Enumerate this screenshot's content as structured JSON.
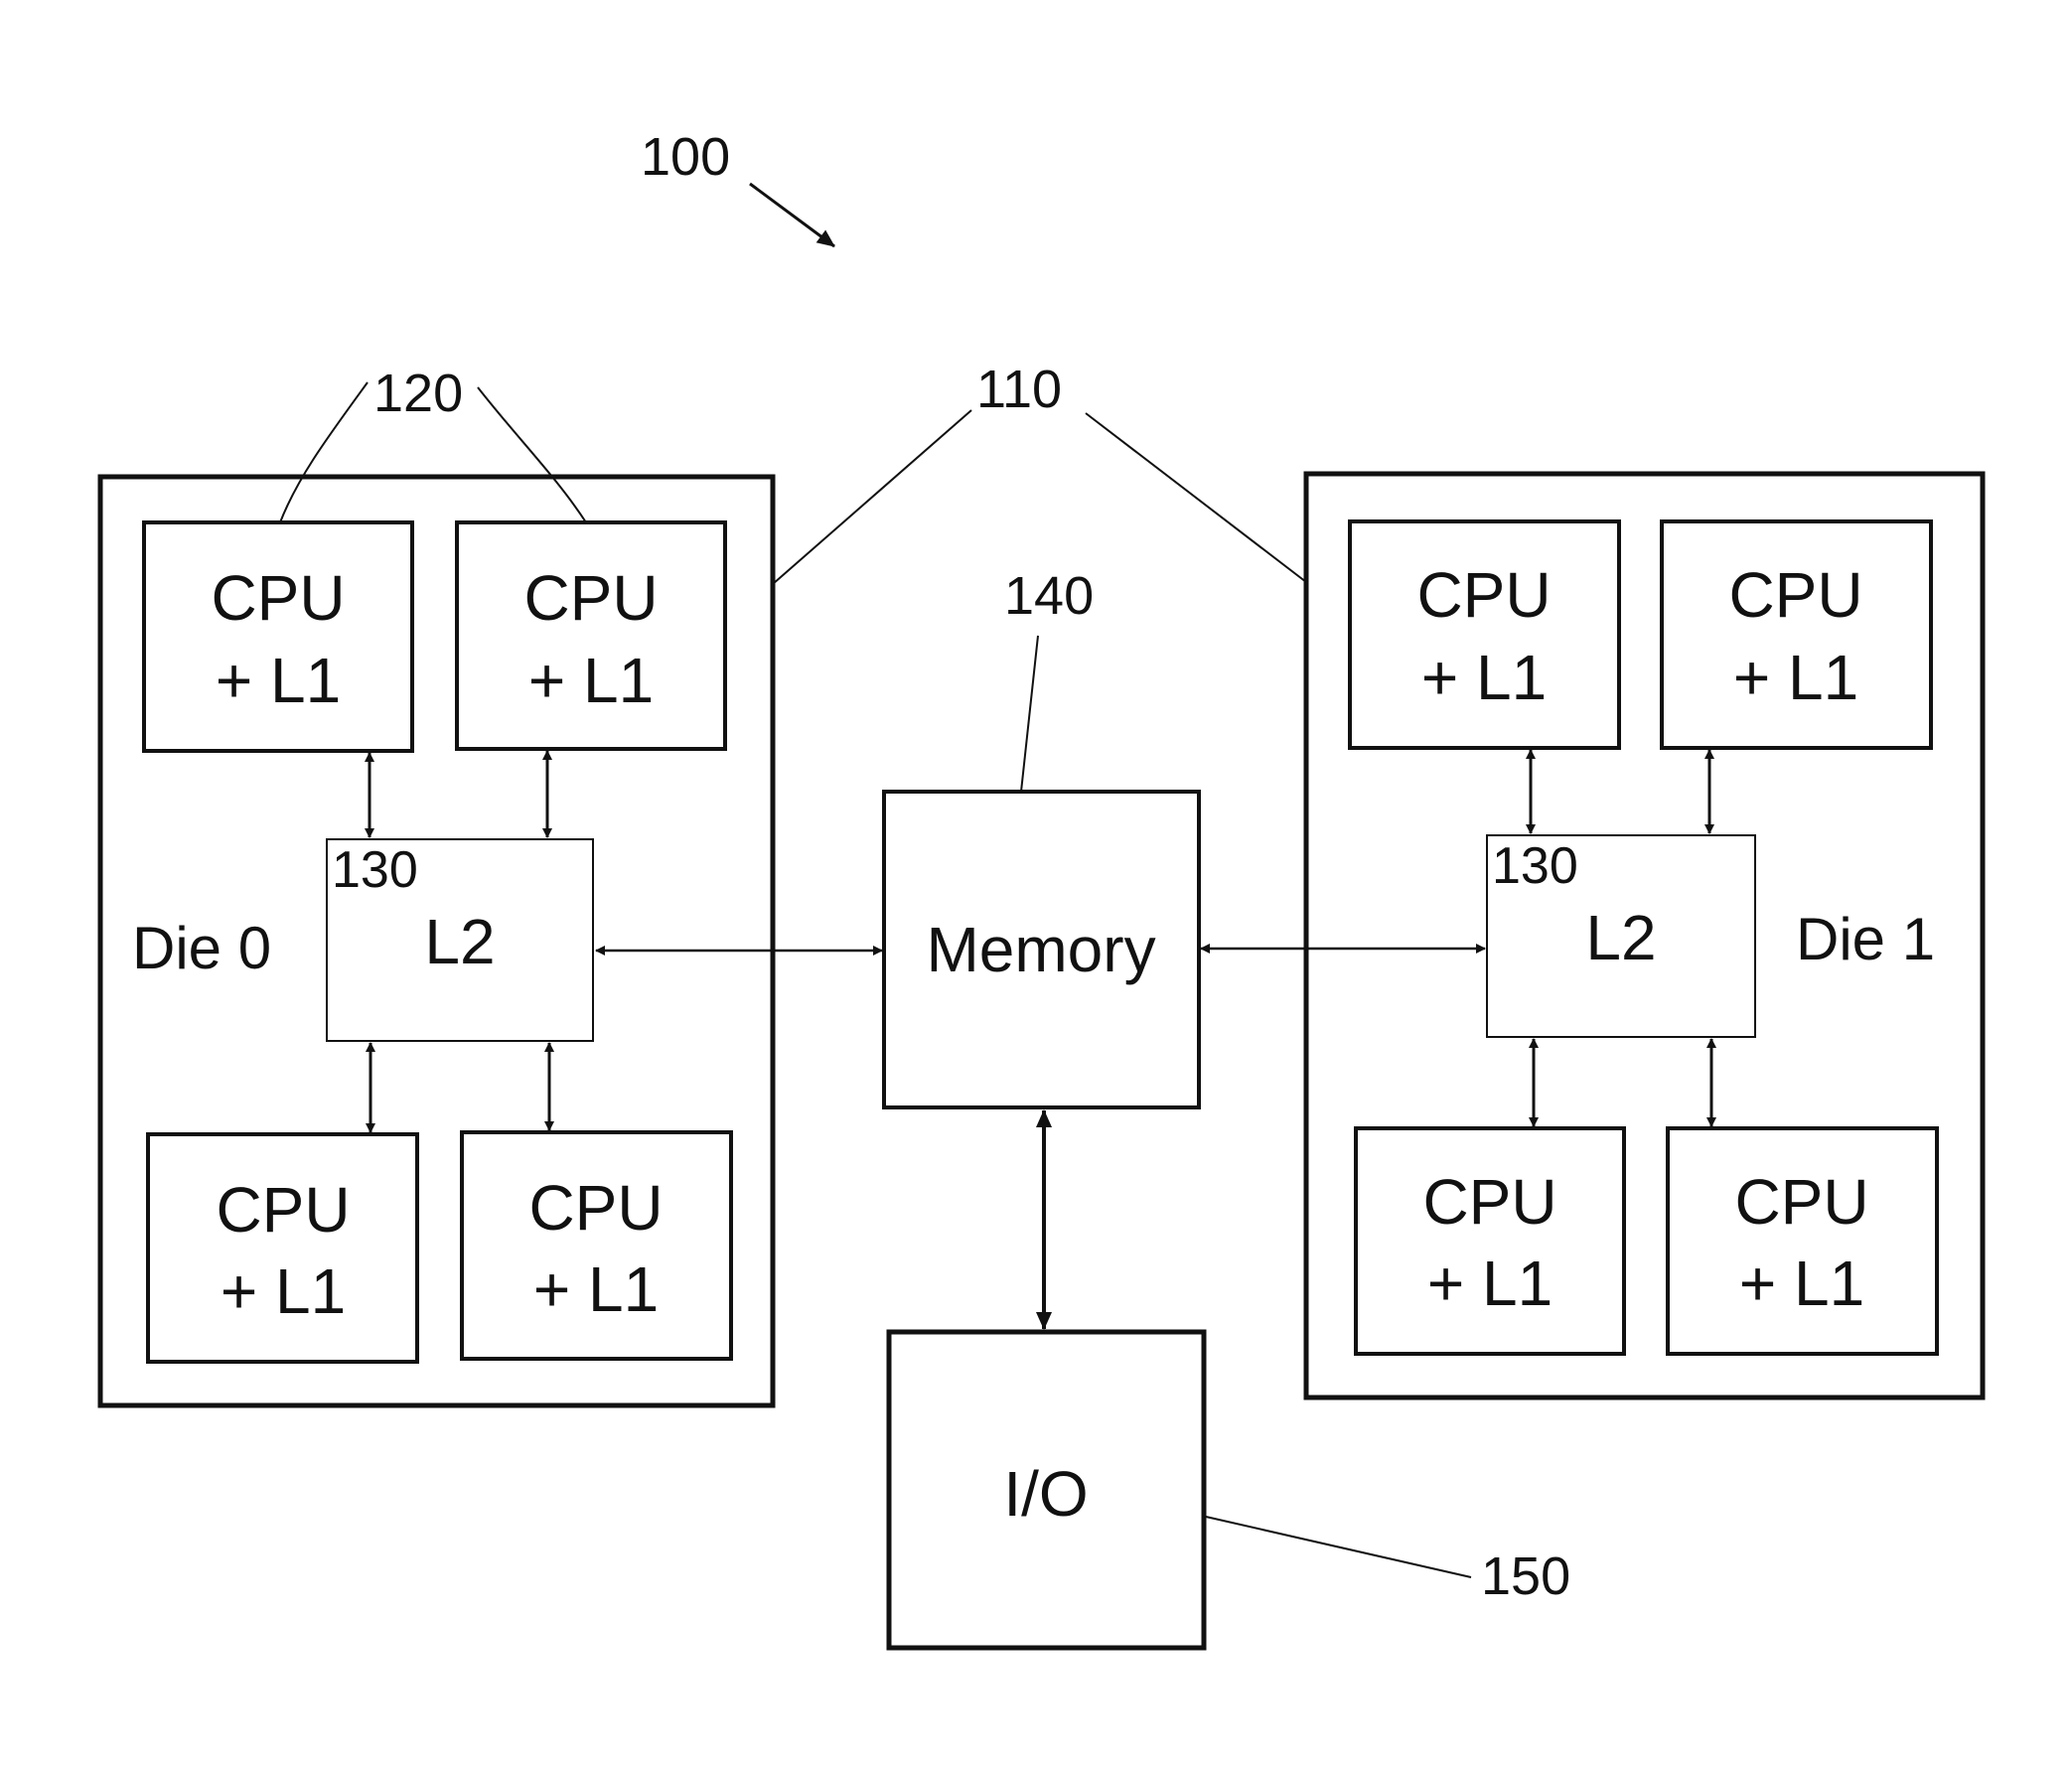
{
  "figure": {
    "ref_system": "100",
    "ref_die": "110",
    "ref_cpu": "120",
    "ref_l2": "130",
    "ref_memory": "140",
    "ref_io": "150"
  },
  "dies": [
    {
      "label": "Die 0",
      "l2_label": "L2",
      "l2_ref": "130",
      "cpus": [
        {
          "line1": "CPU",
          "line2": "+ L1"
        },
        {
          "line1": "CPU",
          "line2": "+ L1"
        },
        {
          "line1": "CPU",
          "line2": "+ L1"
        },
        {
          "line1": "CPU",
          "line2": "+ L1"
        }
      ]
    },
    {
      "label": "Die 1",
      "l2_label": "L2",
      "l2_ref": "130",
      "cpus": [
        {
          "line1": "CPU",
          "line2": "+ L1"
        },
        {
          "line1": "CPU",
          "line2": "+ L1"
        },
        {
          "line1": "CPU",
          "line2": "+ L1"
        },
        {
          "line1": "CPU",
          "line2": "+ L1"
        }
      ]
    }
  ],
  "memory": {
    "label": "Memory"
  },
  "io": {
    "label": "I/O"
  }
}
